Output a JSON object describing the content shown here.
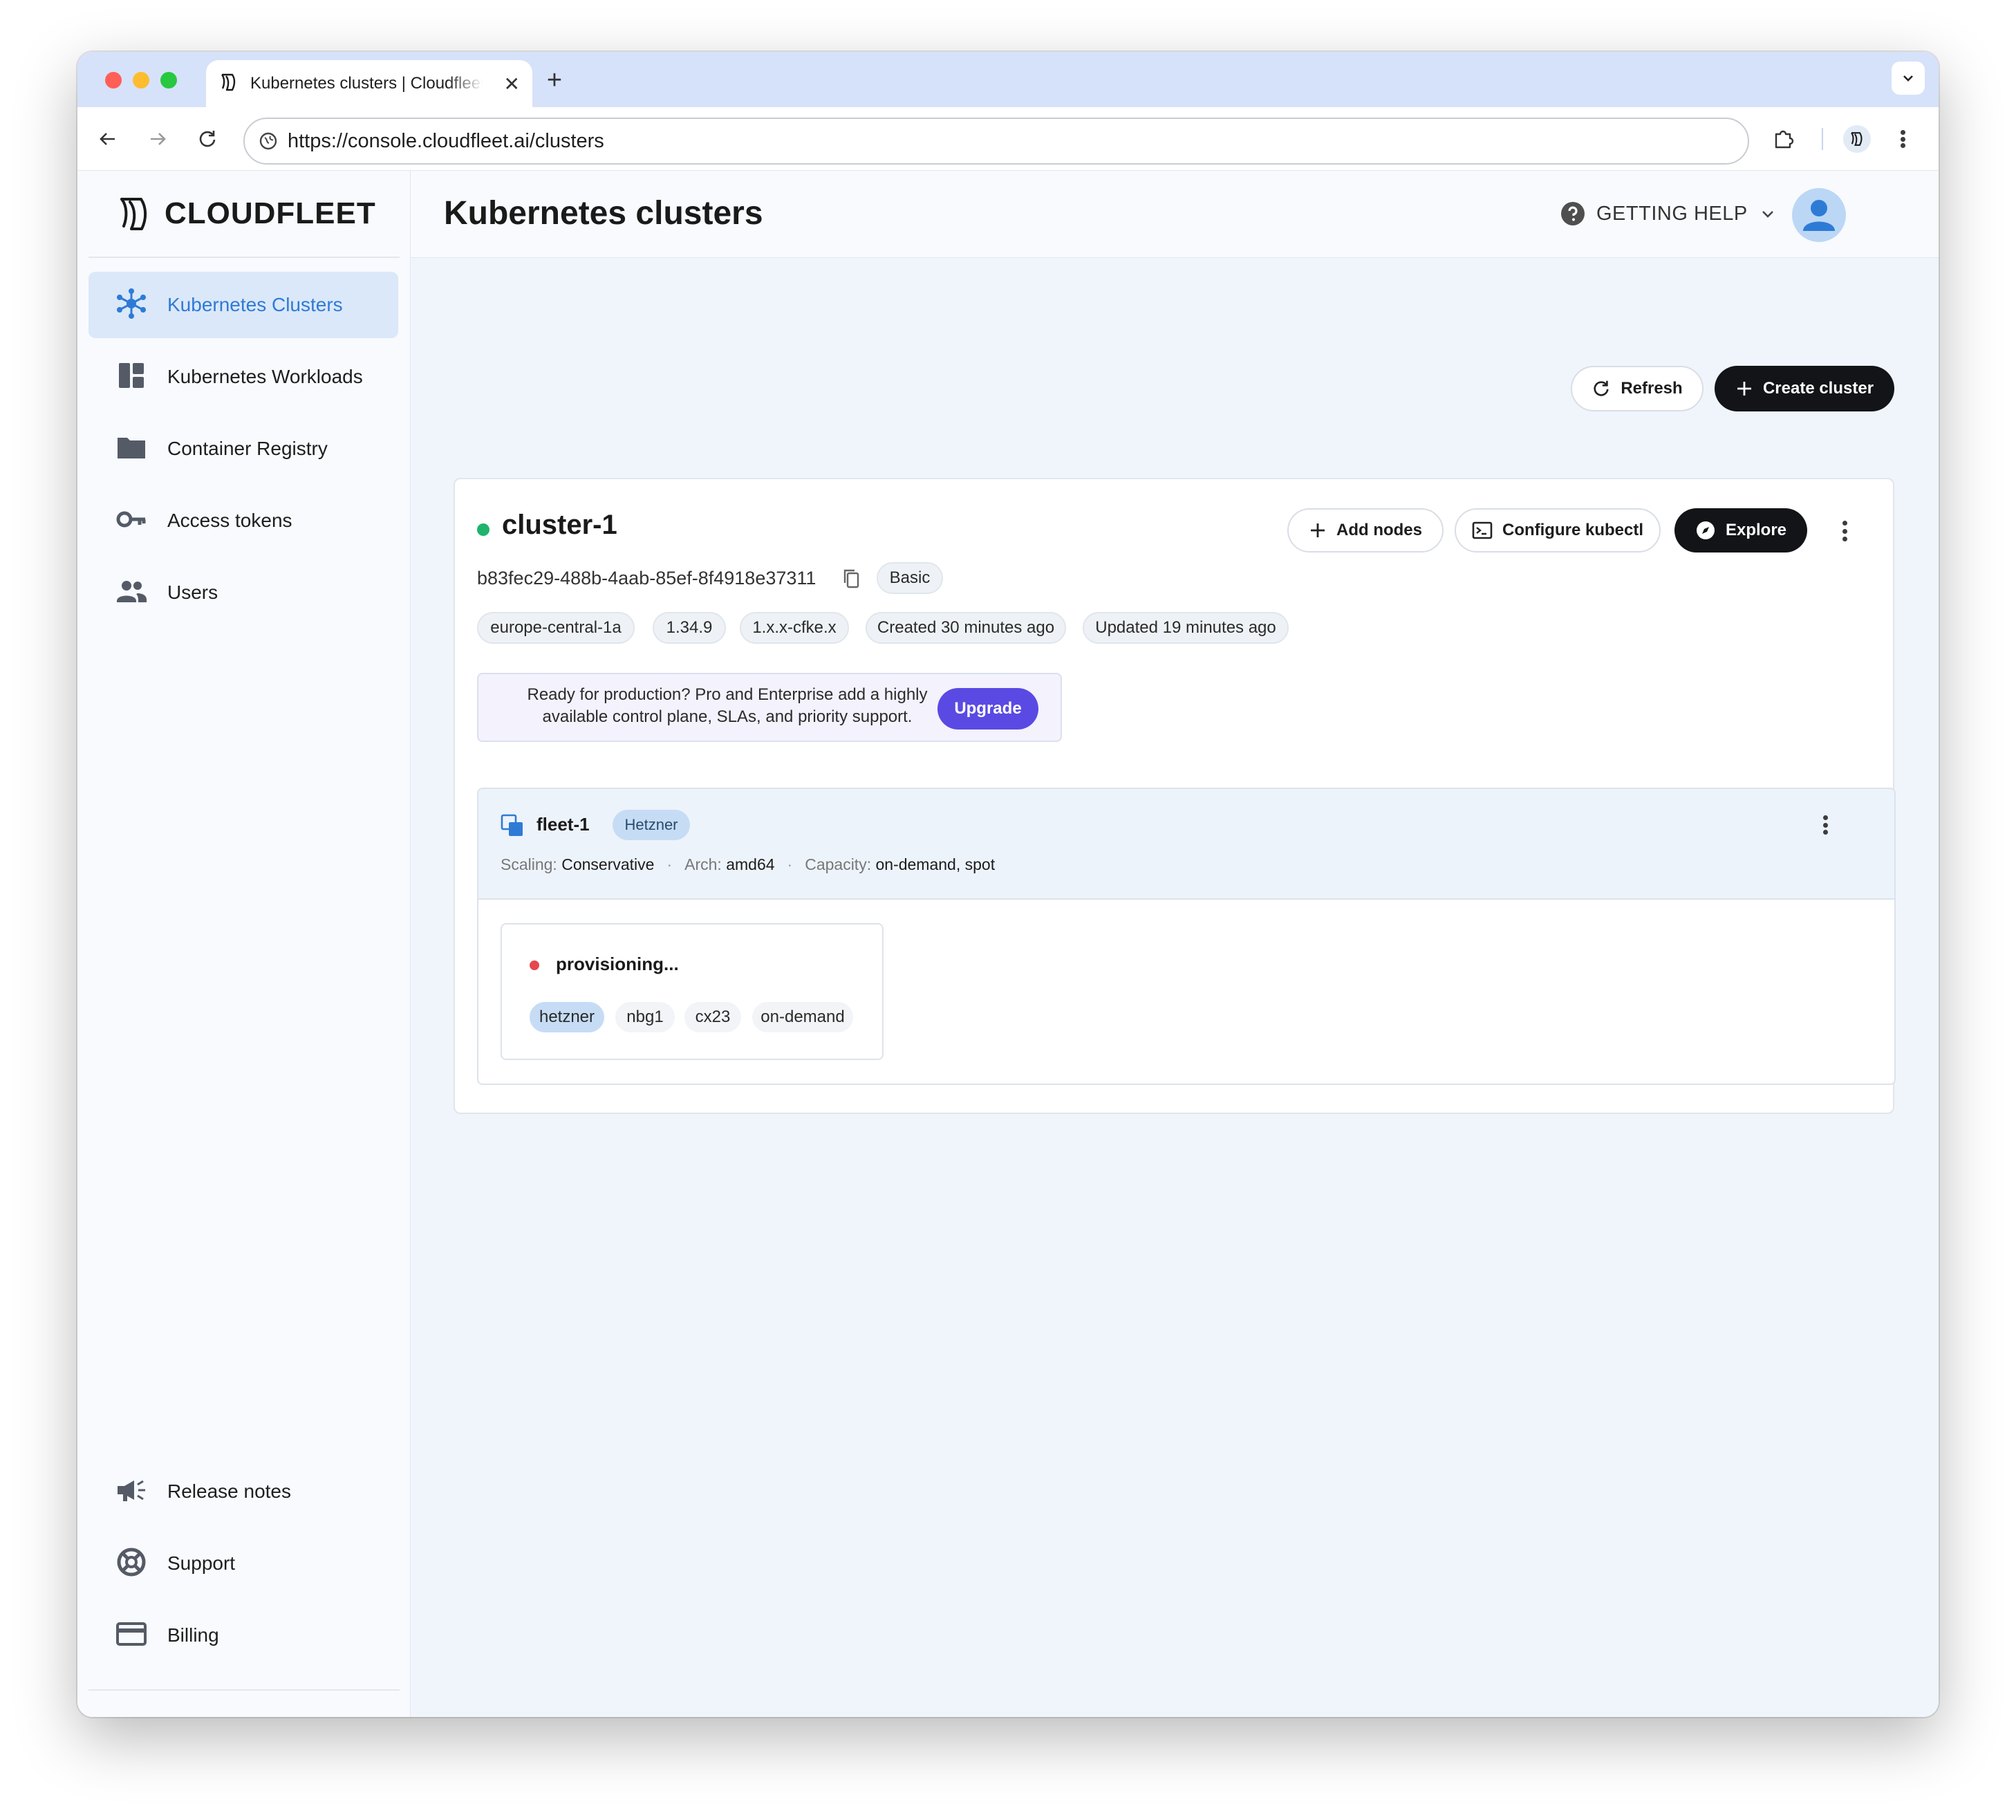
{
  "browser": {
    "tab_title": "Kubernetes clusters | Cloudfleet",
    "url": "https://console.cloudfleet.ai/clusters"
  },
  "sidebar": {
    "brand": "CLOUDFLEET",
    "items": [
      {
        "label": "Kubernetes Clusters",
        "icon": "clusters-icon",
        "active": true
      },
      {
        "label": "Kubernetes Workloads",
        "icon": "dashboard-icon"
      },
      {
        "label": "Container Registry",
        "icon": "folder-icon"
      },
      {
        "label": "Access tokens",
        "icon": "key-icon"
      },
      {
        "label": "Users",
        "icon": "users-icon"
      }
    ],
    "footer_items": [
      {
        "label": "Release notes",
        "icon": "megaphone-icon"
      },
      {
        "label": "Support",
        "icon": "lifebuoy-icon"
      },
      {
        "label": "Billing",
        "icon": "credit-card-icon"
      }
    ]
  },
  "header": {
    "title": "Kubernetes clusters",
    "help_label": "GETTING HELP"
  },
  "actions": {
    "refresh": "Refresh",
    "create": "Create cluster"
  },
  "cluster": {
    "name": "cluster-1",
    "status_color": "#1fb36b",
    "id": "b83fec29-488b-4aab-85ef-8f4918e37311",
    "tier": "Basic",
    "buttons": {
      "add_nodes": "Add nodes",
      "kubectl": "Configure kubectl",
      "explore": "Explore"
    },
    "chips": [
      "europe-central-1a",
      "1.34.9",
      "1.x.x-cfke.x",
      "Created 30 minutes ago",
      "Updated 19 minutes ago"
    ],
    "upsell": {
      "text": "Ready for production? Pro and Enterprise add a highly available control plane, SLAs, and priority support.",
      "button": "Upgrade"
    },
    "fleet": {
      "name": "fleet-1",
      "provider": "Hetzner",
      "scaling_label": "Scaling:",
      "scaling": "Conservative",
      "arch_label": "Arch:",
      "arch": "amd64",
      "capacity_label": "Capacity:",
      "capacity": "on-demand, spot",
      "node": {
        "status": "provisioning...",
        "status_color": "#e5484d",
        "tags": [
          "hetzner",
          "nbg1",
          "cx23",
          "on-demand"
        ]
      }
    }
  },
  "colors": {
    "accent": "#2e7bd6",
    "upgrade": "#5a4ae3",
    "dark_button": "#121417"
  }
}
